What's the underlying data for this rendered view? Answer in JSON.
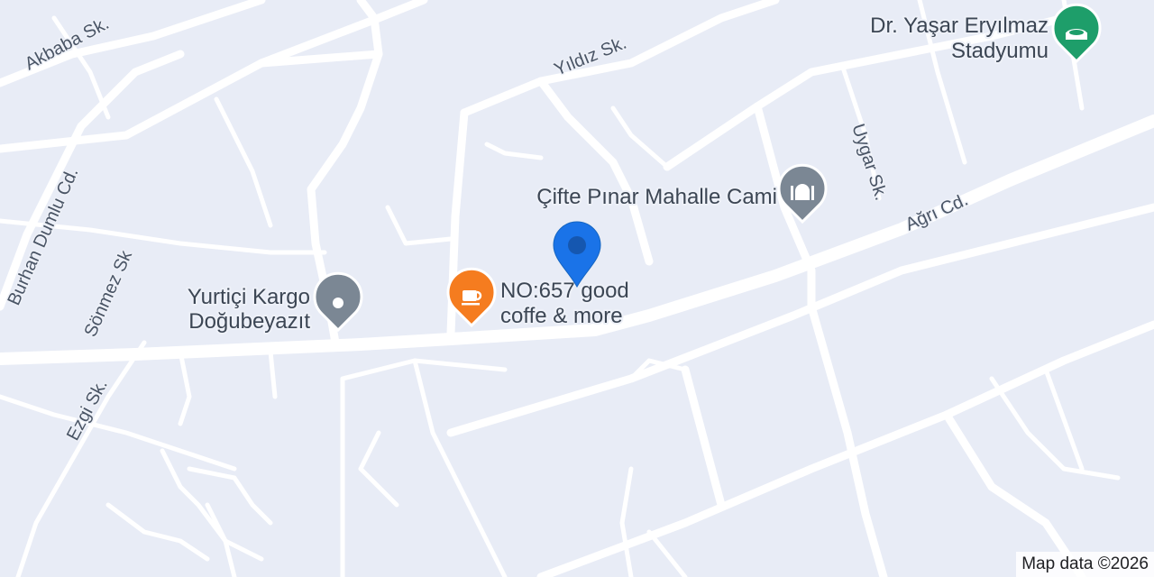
{
  "streets": {
    "akbaba": "Akbaba Sk.",
    "yildiz": "Yıldız Sk.",
    "burhan": "Burhan Dumlu Cd.",
    "sonmez": "Sönmez Sk",
    "ezgi": "Ezgi Sk.",
    "uygar": "Uygar Sk.",
    "agri": "Ağrı Cd."
  },
  "pois": {
    "stadium": {
      "line1": "Dr. Yaşar Eryılmaz",
      "line2": "Stadyumu",
      "icon": "stadium-icon",
      "color": "#1e9e6a"
    },
    "mosque": {
      "line1": "Çifte Pınar Mahalle Cami",
      "icon": "mosque-icon",
      "color": "#7b8794"
    },
    "kargo": {
      "line1": "Yurtiçi Kargo",
      "line2": "Doğubeyazıt",
      "icon": "place-icon",
      "color": "#7b8794"
    },
    "cafe": {
      "line1": "NO:657 good",
      "line2": "coffe & more",
      "icon": "coffee-cup-icon",
      "color": "#f57c1f"
    }
  },
  "location_pin": {
    "icon": "location-pin-icon",
    "color": "#1a73e8"
  },
  "attribution": "Map data ©2026",
  "colors": {
    "background": "#e8ecf6",
    "road": "#ffffff"
  }
}
